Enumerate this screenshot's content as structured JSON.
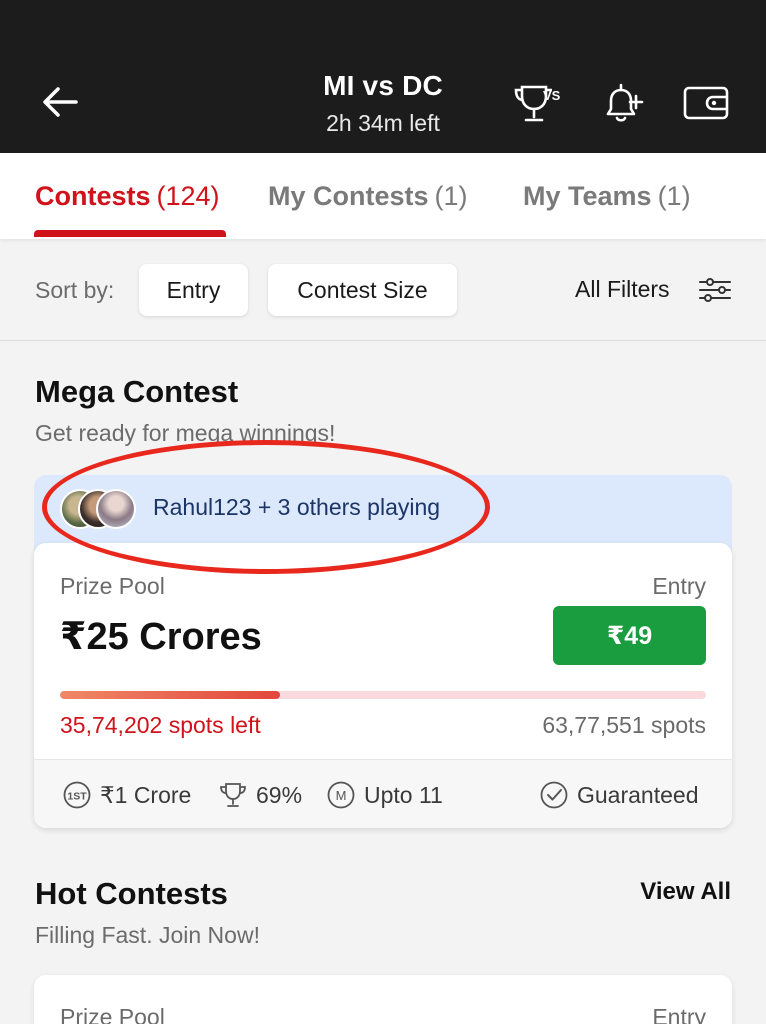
{
  "header": {
    "title": "MI vs DC",
    "subtitle": "2h 34m left"
  },
  "tabs": [
    {
      "label": "Contests",
      "count": "(124)"
    },
    {
      "label": "My Contests",
      "count": "(1)"
    },
    {
      "label": "My Teams",
      "count": "(1)"
    }
  ],
  "sort": {
    "label": "Sort by:",
    "options": [
      "Entry",
      "Contest Size"
    ],
    "filters_label": "All Filters"
  },
  "mega": {
    "title": "Mega Contest",
    "subtitle": "Get ready for mega winnings!",
    "social_text": "Rahul123 + 3 others playing",
    "prize_pool_label": "Prize Pool",
    "prize_pool": "₹25 Crores",
    "entry_label": "Entry",
    "entry_fee": "₹49",
    "fill_fraction": 0.34,
    "spots_left": "35,74,202 spots left",
    "total_spots": "63,77,551 spots",
    "first_prize": "₹1 Crore",
    "first_badge": "1ST",
    "win_percent": "69%",
    "max_teams_badge": "M",
    "max_teams": "Upto 11",
    "guaranteed": "Guaranteed"
  },
  "hot": {
    "title": "Hot Contests",
    "subtitle": "Filling Fast. Join Now!",
    "view_all": "View All",
    "prize_pool_label": "Prize Pool",
    "entry_label": "Entry"
  },
  "colors": {
    "accent": "#d0121b",
    "entry_button": "#1a9d3f",
    "header_bg": "#1c1c1c",
    "social_bg": "#dce8fb"
  }
}
